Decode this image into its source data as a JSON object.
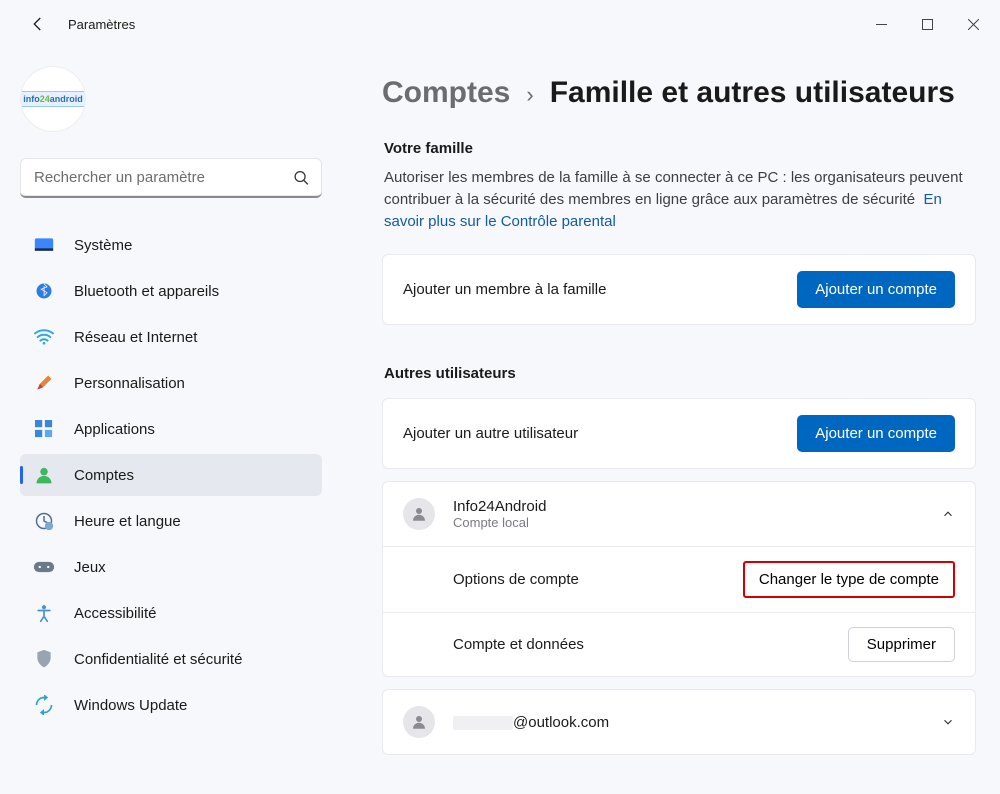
{
  "window": {
    "title": "Paramètres"
  },
  "search": {
    "placeholder": "Rechercher un paramètre"
  },
  "nav": {
    "items": [
      {
        "label": "Système"
      },
      {
        "label": "Bluetooth et appareils"
      },
      {
        "label": "Réseau et Internet"
      },
      {
        "label": "Personnalisation"
      },
      {
        "label": "Applications"
      },
      {
        "label": "Comptes"
      },
      {
        "label": "Heure et langue"
      },
      {
        "label": "Jeux"
      },
      {
        "label": "Accessibilité"
      },
      {
        "label": "Confidentialité et sécurité"
      },
      {
        "label": "Windows Update"
      }
    ]
  },
  "breadcrumb": {
    "parent": "Comptes",
    "current": "Famille et autres utilisateurs"
  },
  "family": {
    "heading": "Votre famille",
    "desc": "Autoriser les membres de la famille à se connecter à ce PC : les organisateurs peuvent contribuer à la sécurité des membres en ligne grâce aux paramètres de sécurité",
    "link": "En savoir plus sur le Contrôle parental",
    "add_label": "Ajouter un membre à la famille",
    "add_button": "Ajouter un compte"
  },
  "others": {
    "heading": "Autres utilisateurs",
    "add_label": "Ajouter un autre utilisateur",
    "add_button": "Ajouter un compte",
    "user1": {
      "name": "Info24Android",
      "type": "Compte local",
      "options_label": "Options de compte",
      "change_type_button": "Changer le type de compte",
      "data_label": "Compte et données",
      "remove_button": "Supprimer"
    },
    "user2": {
      "email": "@outlook.com"
    }
  }
}
